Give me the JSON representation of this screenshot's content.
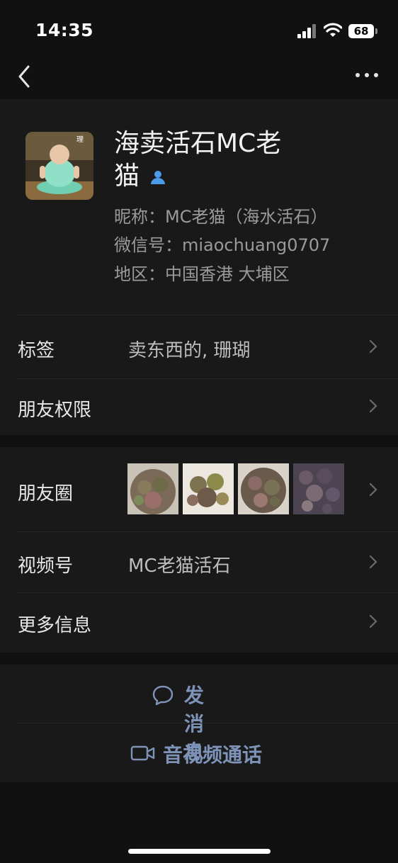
{
  "status_bar": {
    "time": "14:35",
    "battery": "68",
    "icons": [
      "cellular-signal-icon",
      "wifi-icon",
      "battery-icon"
    ]
  },
  "nav": {
    "back_icon": "chevron-left-icon",
    "more_icon": "ellipsis-icon"
  },
  "profile": {
    "name_line1": "海卖活石MC老",
    "name_line2": "猫",
    "gender_icon": "person-icon",
    "nickname": "昵称：MC老猫（海水活石）",
    "wechat_id": "微信号：miaochuang0707",
    "region": "地区：中国香港 大埔区"
  },
  "rows": {
    "tags_label": "标签",
    "tags_value": "卖东西的, 珊瑚",
    "permissions_label": "朋友权限",
    "moments_label": "朋友圈",
    "channels_label": "视频号",
    "channels_value": "MC老猫活石",
    "more_info_label": "更多信息"
  },
  "actions": {
    "message_label": "发消息",
    "call_label": "音视频通话"
  },
  "colors": {
    "background": "#111111",
    "panel": "#191919",
    "action_text": "#7e93b8",
    "secondary_text": "#9a9a9a"
  }
}
